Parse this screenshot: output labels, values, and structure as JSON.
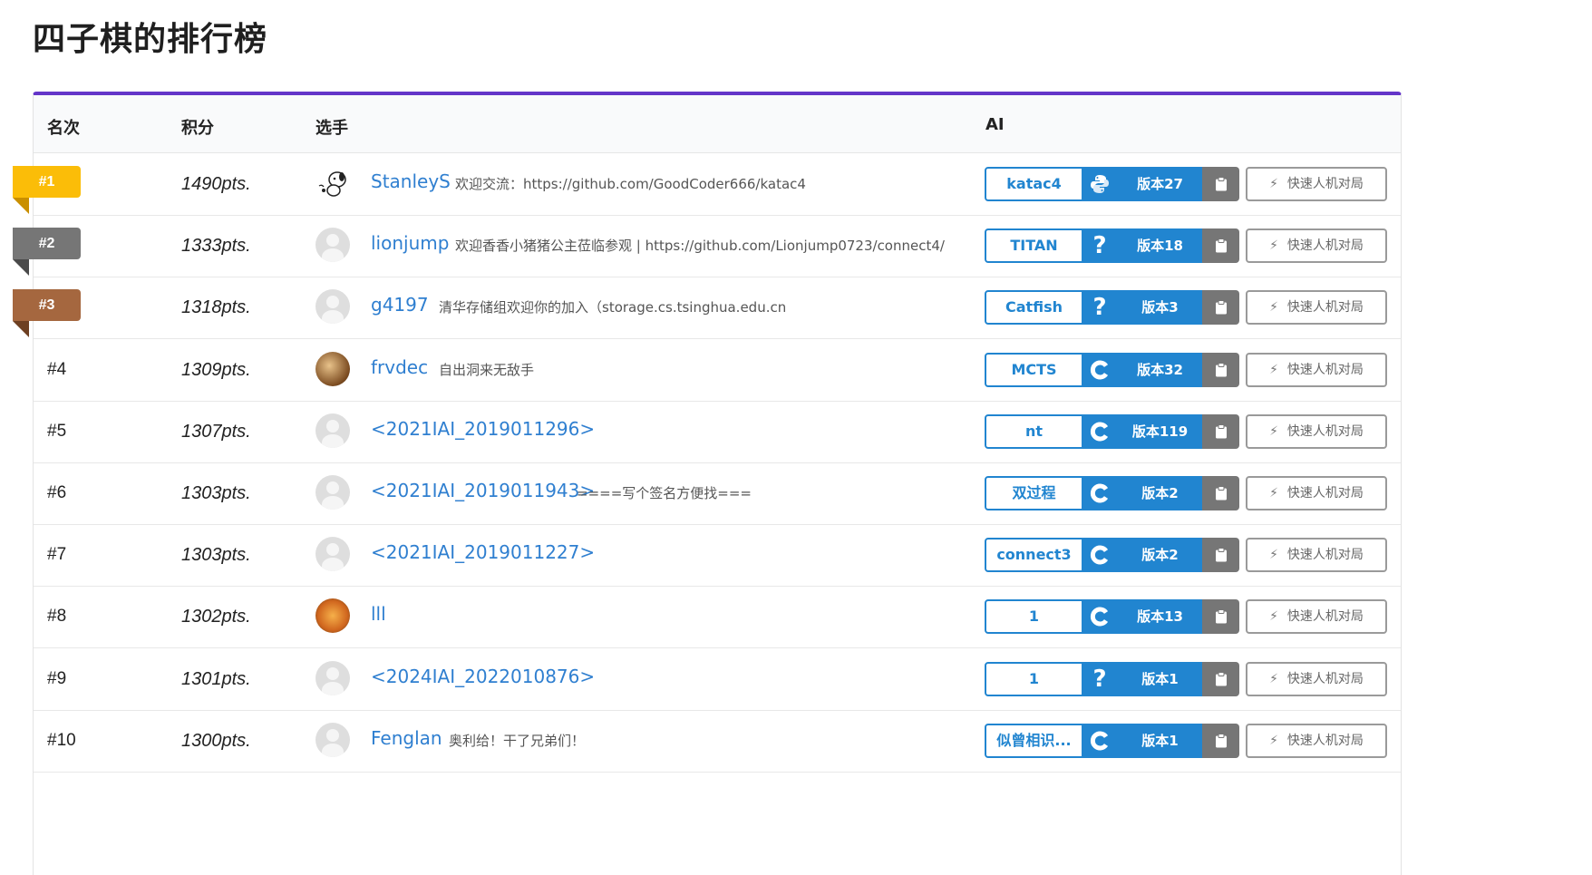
{
  "page": {
    "title": "四子棋的排行榜"
  },
  "table": {
    "headers": {
      "rank": "名次",
      "score": "积分",
      "player": "选手",
      "ai": "AI"
    },
    "quick_label": "快速人机对局",
    "rows": [
      {
        "rank": "#1",
        "score": "1490pts.",
        "avatar": "avatar-dog",
        "name": "StanleyS",
        "motto": "欢迎交流：https://github.com/GoodCoder666/katac4",
        "ai_name": "katac4",
        "lang": "python-icon",
        "version": "版本27"
      },
      {
        "rank": "#2",
        "score": "1333pts.",
        "avatar": "avatar-default",
        "name": "lionjump",
        "motto": "欢迎香香小猪猪公主莅临参观 | https://github.com/Lionjump0723/connect4/",
        "ai_name": "TITAN",
        "lang": "unknown-icon",
        "version": "版本18"
      },
      {
        "rank": "#3",
        "score": "1318pts.",
        "avatar": "avatar-default",
        "name": "g4197",
        "motto": "清华存储组欢迎你的加入（storage.cs.tsinghua.edu.cn",
        "ai_name": "Catfish",
        "lang": "unknown-icon",
        "version": "版本3"
      },
      {
        "rank": "#4",
        "score": "1309pts.",
        "avatar": "avatar-food",
        "name": "frvdec",
        "motto": "自出洞来无敌手",
        "ai_name": "MCTS",
        "lang": "c-icon",
        "version": "版本32"
      },
      {
        "rank": "#5",
        "score": "1307pts.",
        "avatar": "avatar-default",
        "name": "<2021IAI_2019011296>",
        "motto": "",
        "ai_name": "nt",
        "lang": "c-icon",
        "version": "版本119"
      },
      {
        "rank": "#6",
        "score": "1303pts.",
        "avatar": "avatar-default",
        "name": "<2021IAI_2019011943>",
        "motto": "====写个签名方便找===",
        "ai_name": "双过程",
        "lang": "c-icon",
        "version": "版本2"
      },
      {
        "rank": "#7",
        "score": "1303pts.",
        "avatar": "avatar-default",
        "name": "<2021IAI_2019011227>",
        "motto": "",
        "ai_name": "connect3",
        "lang": "c-icon",
        "version": "版本2"
      },
      {
        "rank": "#8",
        "score": "1302pts.",
        "avatar": "avatar-orange",
        "name": "lll",
        "motto": "",
        "ai_name": "1",
        "lang": "c-icon",
        "version": "版本13"
      },
      {
        "rank": "#9",
        "score": "1301pts.",
        "avatar": "avatar-default",
        "name": "<2024IAI_2022010876>",
        "motto": "",
        "ai_name": "1",
        "lang": "unknown-icon",
        "version": "版本1"
      },
      {
        "rank": "#10",
        "score": "1300pts.",
        "avatar": "avatar-default",
        "name": "Fenglan",
        "motto": "奥利给！干了兄弟们！",
        "ai_name": "似曾相识...",
        "lang": "c-icon",
        "version": "版本1"
      }
    ]
  },
  "colors": {
    "accent": "#6435c9",
    "link": "#2f7fd0",
    "ai_blue": "#2185d0",
    "gold": "#fbbd08",
    "silver": "#767676",
    "bronze": "#a5673f"
  }
}
